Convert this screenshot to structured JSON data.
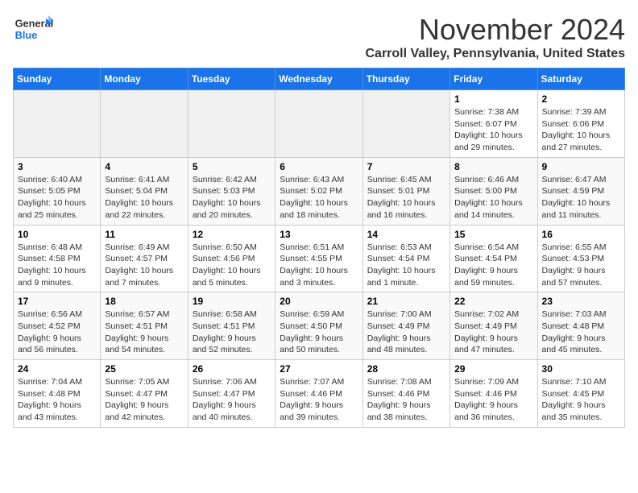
{
  "header": {
    "logo_line1": "General",
    "logo_line2": "Blue",
    "month_title": "November 2024",
    "location": "Carroll Valley, Pennsylvania, United States"
  },
  "weekdays": [
    "Sunday",
    "Monday",
    "Tuesday",
    "Wednesday",
    "Thursday",
    "Friday",
    "Saturday"
  ],
  "weeks": [
    [
      {
        "day": "",
        "sunrise": "",
        "sunset": "",
        "daylight": ""
      },
      {
        "day": "",
        "sunrise": "",
        "sunset": "",
        "daylight": ""
      },
      {
        "day": "",
        "sunrise": "",
        "sunset": "",
        "daylight": ""
      },
      {
        "day": "",
        "sunrise": "",
        "sunset": "",
        "daylight": ""
      },
      {
        "day": "",
        "sunrise": "",
        "sunset": "",
        "daylight": ""
      },
      {
        "day": "1",
        "sunrise": "Sunrise: 7:38 AM",
        "sunset": "Sunset: 6:07 PM",
        "daylight": "Daylight: 10 hours and 29 minutes."
      },
      {
        "day": "2",
        "sunrise": "Sunrise: 7:39 AM",
        "sunset": "Sunset: 6:06 PM",
        "daylight": "Daylight: 10 hours and 27 minutes."
      }
    ],
    [
      {
        "day": "3",
        "sunrise": "Sunrise: 6:40 AM",
        "sunset": "Sunset: 5:05 PM",
        "daylight": "Daylight: 10 hours and 25 minutes."
      },
      {
        "day": "4",
        "sunrise": "Sunrise: 6:41 AM",
        "sunset": "Sunset: 5:04 PM",
        "daylight": "Daylight: 10 hours and 22 minutes."
      },
      {
        "day": "5",
        "sunrise": "Sunrise: 6:42 AM",
        "sunset": "Sunset: 5:03 PM",
        "daylight": "Daylight: 10 hours and 20 minutes."
      },
      {
        "day": "6",
        "sunrise": "Sunrise: 6:43 AM",
        "sunset": "Sunset: 5:02 PM",
        "daylight": "Daylight: 10 hours and 18 minutes."
      },
      {
        "day": "7",
        "sunrise": "Sunrise: 6:45 AM",
        "sunset": "Sunset: 5:01 PM",
        "daylight": "Daylight: 10 hours and 16 minutes."
      },
      {
        "day": "8",
        "sunrise": "Sunrise: 6:46 AM",
        "sunset": "Sunset: 5:00 PM",
        "daylight": "Daylight: 10 hours and 14 minutes."
      },
      {
        "day": "9",
        "sunrise": "Sunrise: 6:47 AM",
        "sunset": "Sunset: 4:59 PM",
        "daylight": "Daylight: 10 hours and 11 minutes."
      }
    ],
    [
      {
        "day": "10",
        "sunrise": "Sunrise: 6:48 AM",
        "sunset": "Sunset: 4:58 PM",
        "daylight": "Daylight: 10 hours and 9 minutes."
      },
      {
        "day": "11",
        "sunrise": "Sunrise: 6:49 AM",
        "sunset": "Sunset: 4:57 PM",
        "daylight": "Daylight: 10 hours and 7 minutes."
      },
      {
        "day": "12",
        "sunrise": "Sunrise: 6:50 AM",
        "sunset": "Sunset: 4:56 PM",
        "daylight": "Daylight: 10 hours and 5 minutes."
      },
      {
        "day": "13",
        "sunrise": "Sunrise: 6:51 AM",
        "sunset": "Sunset: 4:55 PM",
        "daylight": "Daylight: 10 hours and 3 minutes."
      },
      {
        "day": "14",
        "sunrise": "Sunrise: 6:53 AM",
        "sunset": "Sunset: 4:54 PM",
        "daylight": "Daylight: 10 hours and 1 minute."
      },
      {
        "day": "15",
        "sunrise": "Sunrise: 6:54 AM",
        "sunset": "Sunset: 4:54 PM",
        "daylight": "Daylight: 9 hours and 59 minutes."
      },
      {
        "day": "16",
        "sunrise": "Sunrise: 6:55 AM",
        "sunset": "Sunset: 4:53 PM",
        "daylight": "Daylight: 9 hours and 57 minutes."
      }
    ],
    [
      {
        "day": "17",
        "sunrise": "Sunrise: 6:56 AM",
        "sunset": "Sunset: 4:52 PM",
        "daylight": "Daylight: 9 hours and 56 minutes."
      },
      {
        "day": "18",
        "sunrise": "Sunrise: 6:57 AM",
        "sunset": "Sunset: 4:51 PM",
        "daylight": "Daylight: 9 hours and 54 minutes."
      },
      {
        "day": "19",
        "sunrise": "Sunrise: 6:58 AM",
        "sunset": "Sunset: 4:51 PM",
        "daylight": "Daylight: 9 hours and 52 minutes."
      },
      {
        "day": "20",
        "sunrise": "Sunrise: 6:59 AM",
        "sunset": "Sunset: 4:50 PM",
        "daylight": "Daylight: 9 hours and 50 minutes."
      },
      {
        "day": "21",
        "sunrise": "Sunrise: 7:00 AM",
        "sunset": "Sunset: 4:49 PM",
        "daylight": "Daylight: 9 hours and 48 minutes."
      },
      {
        "day": "22",
        "sunrise": "Sunrise: 7:02 AM",
        "sunset": "Sunset: 4:49 PM",
        "daylight": "Daylight: 9 hours and 47 minutes."
      },
      {
        "day": "23",
        "sunrise": "Sunrise: 7:03 AM",
        "sunset": "Sunset: 4:48 PM",
        "daylight": "Daylight: 9 hours and 45 minutes."
      }
    ],
    [
      {
        "day": "24",
        "sunrise": "Sunrise: 7:04 AM",
        "sunset": "Sunset: 4:48 PM",
        "daylight": "Daylight: 9 hours and 43 minutes."
      },
      {
        "day": "25",
        "sunrise": "Sunrise: 7:05 AM",
        "sunset": "Sunset: 4:47 PM",
        "daylight": "Daylight: 9 hours and 42 minutes."
      },
      {
        "day": "26",
        "sunrise": "Sunrise: 7:06 AM",
        "sunset": "Sunset: 4:47 PM",
        "daylight": "Daylight: 9 hours and 40 minutes."
      },
      {
        "day": "27",
        "sunrise": "Sunrise: 7:07 AM",
        "sunset": "Sunset: 4:46 PM",
        "daylight": "Daylight: 9 hours and 39 minutes."
      },
      {
        "day": "28",
        "sunrise": "Sunrise: 7:08 AM",
        "sunset": "Sunset: 4:46 PM",
        "daylight": "Daylight: 9 hours and 38 minutes."
      },
      {
        "day": "29",
        "sunrise": "Sunrise: 7:09 AM",
        "sunset": "Sunset: 4:46 PM",
        "daylight": "Daylight: 9 hours and 36 minutes."
      },
      {
        "day": "30",
        "sunrise": "Sunrise: 7:10 AM",
        "sunset": "Sunset: 4:45 PM",
        "daylight": "Daylight: 9 hours and 35 minutes."
      }
    ]
  ]
}
